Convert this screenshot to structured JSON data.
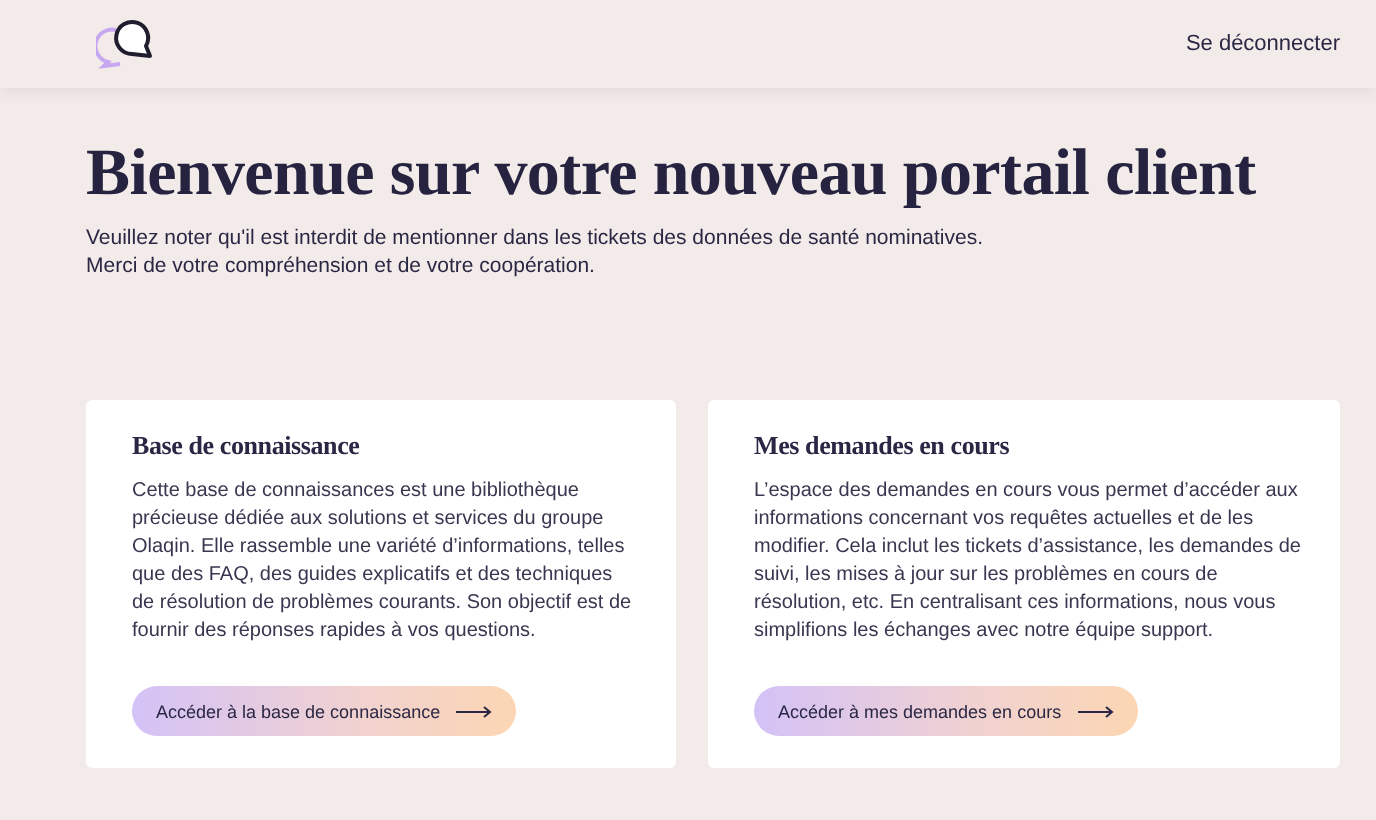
{
  "header": {
    "logout_link": "Se déconnecter"
  },
  "hero": {
    "title": "Bienvenue sur votre nouveau portail client",
    "notice_lines": [
      "Veuillez noter qu'il est interdit de mentionner dans les tickets des données de santé nominatives.",
      "Merci de votre compréhension et de votre coopération."
    ]
  },
  "cards": [
    {
      "title": "Base de connaissance",
      "description": "Cette base de connaissances est une bibliothèque précieuse dédiée aux solutions et services du groupe Olaqin. Elle rassemble une variété d’informations, telles que des FAQ, des guides explicatifs et des techniques de résolution de problèmes courants. Son objectif est de fournir des réponses rapides à vos questions.",
      "button": "Accéder à la base de connaissance"
    },
    {
      "title": "Mes demandes en cours",
      "description": "L’espace des demandes en cours vous permet d’accéder aux informations concernant vos requêtes actuelles et de les modifier. Cela inclut les tickets d’assistance, les demandes de suivi, les mises à jour sur les problèmes en cours de résolution, etc. En centralisant ces informations, nous vous simplifions les échanges avec notre équipe support.",
      "button": "Accéder à mes demandes en cours"
    }
  ]
}
